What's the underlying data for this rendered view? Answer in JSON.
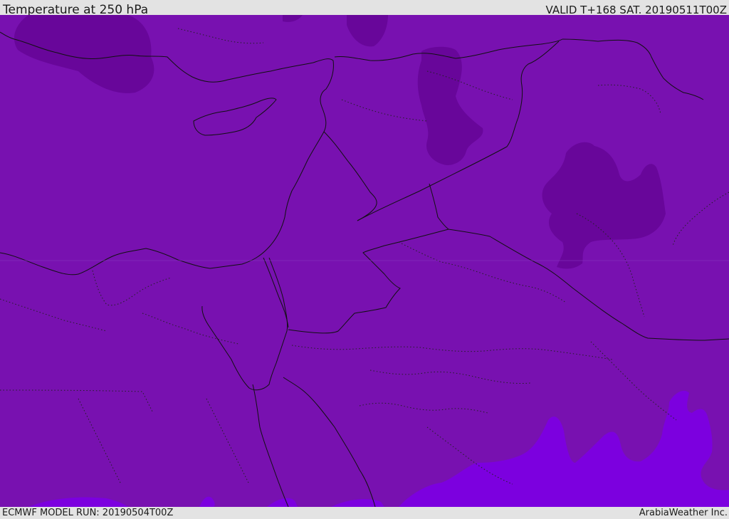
{
  "header": {
    "title": "Temperature at 250 hPa",
    "valid": "VALID T+168 SAT. 20190511T00Z"
  },
  "footer": {
    "model_run": "ECMWF MODEL RUN: 20190504T00Z",
    "credit": "ArabiaWeather Inc."
  },
  "map": {
    "colors": {
      "base": "#7811b0",
      "cold_patch": "#68069a",
      "warm_patch": "#7c00df",
      "border": "#111111"
    },
    "regions": [
      "cold-patch-turkey",
      "cold-patch-syria",
      "cold-patch-iraq",
      "warm-patch-south"
    ]
  }
}
